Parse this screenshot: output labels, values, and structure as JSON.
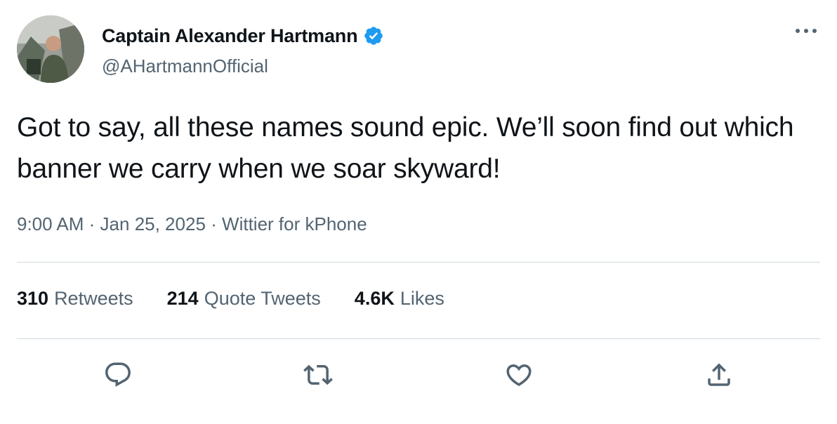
{
  "author": {
    "display_name": "Captain Alexander Hartmann",
    "handle": "@AHartmannOfficial",
    "verified": true,
    "verified_color": "#1d9bf0"
  },
  "tweet": {
    "text": "Got to say, all these names sound epic. We’ll soon find out which banner we carry when we soar skyward!",
    "time": "9:00 AM",
    "separator": "·",
    "date": "Jan 25, 2025",
    "source": "Wittier for kPhone"
  },
  "stats": {
    "retweets_count": "310",
    "retweets_label": "Retweets",
    "quotes_count": "214",
    "quotes_label": "Quote Tweets",
    "likes_count": "4.6K",
    "likes_label": "Likes"
  },
  "icons": {
    "more": "more-horizontal-icon",
    "reply": "reply-bubble-icon",
    "retweet": "retweet-icon",
    "like": "heart-icon",
    "share": "share-upload-icon"
  },
  "colors": {
    "text_primary": "#0f1419",
    "text_secondary": "#536471",
    "divider": "#cfd9de",
    "icon": "#536471"
  }
}
